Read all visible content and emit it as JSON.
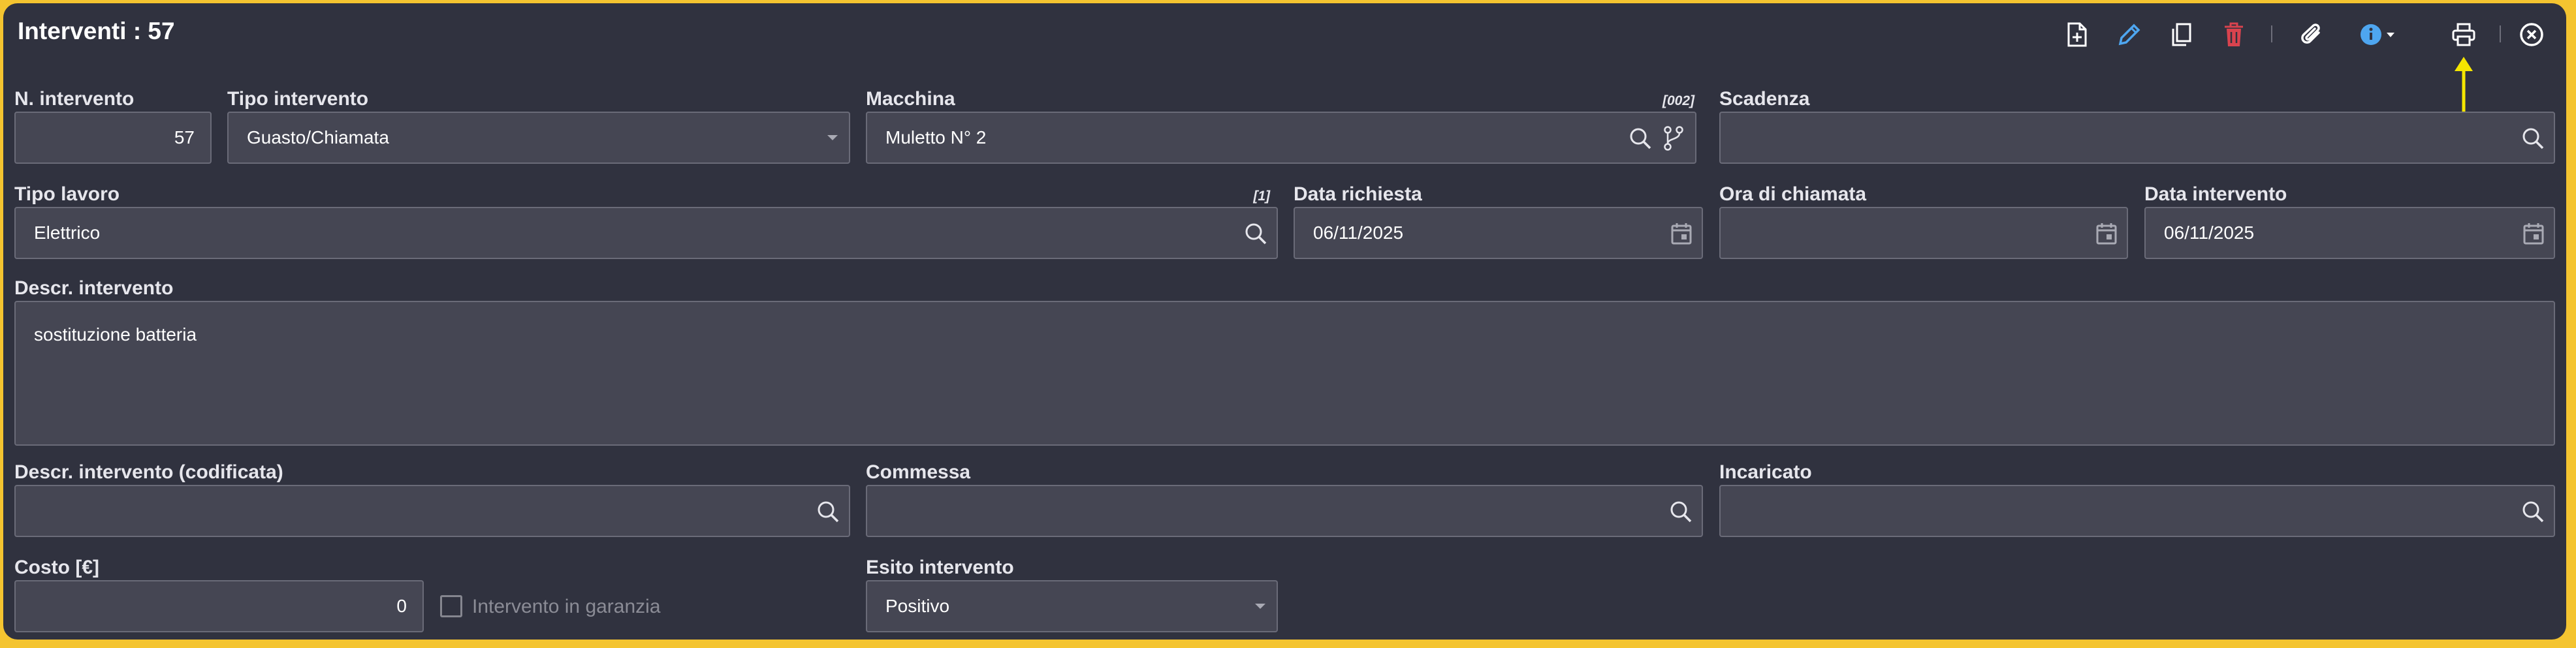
{
  "window": {
    "title": "Interventi : 57"
  },
  "toolbar": {
    "icons": [
      "new-document-icon",
      "edit-pencil-icon",
      "copy-icon",
      "delete-trash-icon",
      "attachment-paperclip-icon",
      "info-icon",
      "print-icon",
      "close-circle-icon"
    ],
    "colors": {
      "edit": "#4ea6f0",
      "delete": "#d9434e",
      "info": "#4ea6f0",
      "highlight_arrow": "#f5e600"
    }
  },
  "form": {
    "n_intervento": {
      "label": "N. intervento",
      "value": "57"
    },
    "tipo_intervento": {
      "label": "Tipo intervento",
      "value": "Guasto/Chiamata"
    },
    "macchina": {
      "label": "Macchina",
      "code": "[002]",
      "value": "Muletto N° 2"
    },
    "scadenza": {
      "label": "Scadenza",
      "value": ""
    },
    "tipo_lavoro": {
      "label": "Tipo lavoro",
      "code": "[1]",
      "value": "Elettrico"
    },
    "data_richiesta": {
      "label": "Data richiesta",
      "value": "06/11/2025"
    },
    "ora_chiamata": {
      "label": "Ora di chiamata",
      "value": ""
    },
    "data_intervento": {
      "label": "Data intervento",
      "value": "06/11/2025"
    },
    "descr_intervento": {
      "label": "Descr. intervento",
      "value": "sostituzione batteria"
    },
    "descr_codificata": {
      "label": "Descr. intervento (codificata)",
      "value": ""
    },
    "commessa": {
      "label": "Commessa",
      "value": ""
    },
    "incaricato": {
      "label": "Incaricato",
      "value": ""
    },
    "costo": {
      "label": "Costo [€]",
      "value": "0"
    },
    "garanzia": {
      "label": "Intervento in garanzia",
      "checked": false
    },
    "esito": {
      "label": "Esito intervento",
      "value": "Positivo"
    }
  }
}
